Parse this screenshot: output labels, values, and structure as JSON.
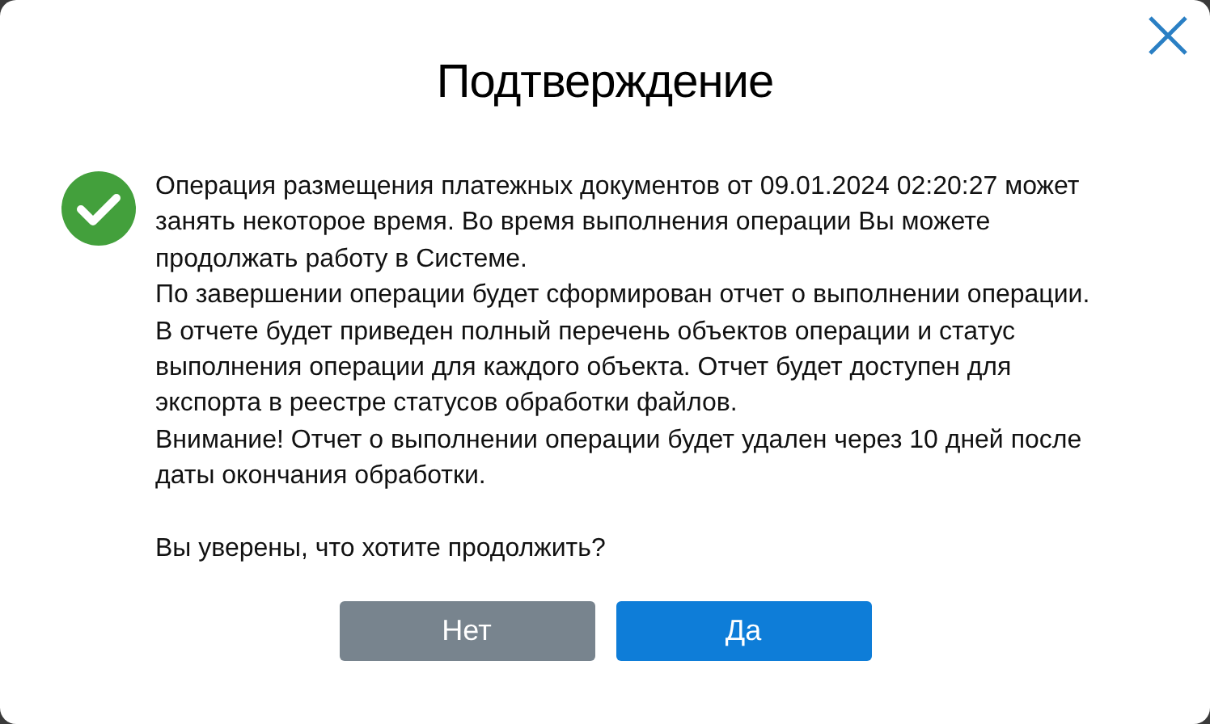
{
  "dialog": {
    "title": "Подтверждение"
  },
  "message": {
    "paragraphs": [
      "Операция размещения платежных документов от 09.01.2024 02:20:27 может занять некоторое время. Во время выполнения операции Вы можете продолжать работу в Системе.",
      "По завершении операции будет сформирован отчет о выполнении операции. В отчете будет приведен полный перечень объектов операции и статус выполнения операции для каждого объекта. Отчет будет доступен для экспорта в реестре статусов обработки файлов.",
      "Внимание! Отчет о выполнении операции будет удален через 10 дней после даты окончания обработки."
    ],
    "question": "Вы уверены, что хотите продолжить?"
  },
  "buttons": [
    {
      "label": "Нет",
      "kind": "secondary"
    },
    {
      "label": "Да",
      "kind": "primary"
    }
  ]
}
